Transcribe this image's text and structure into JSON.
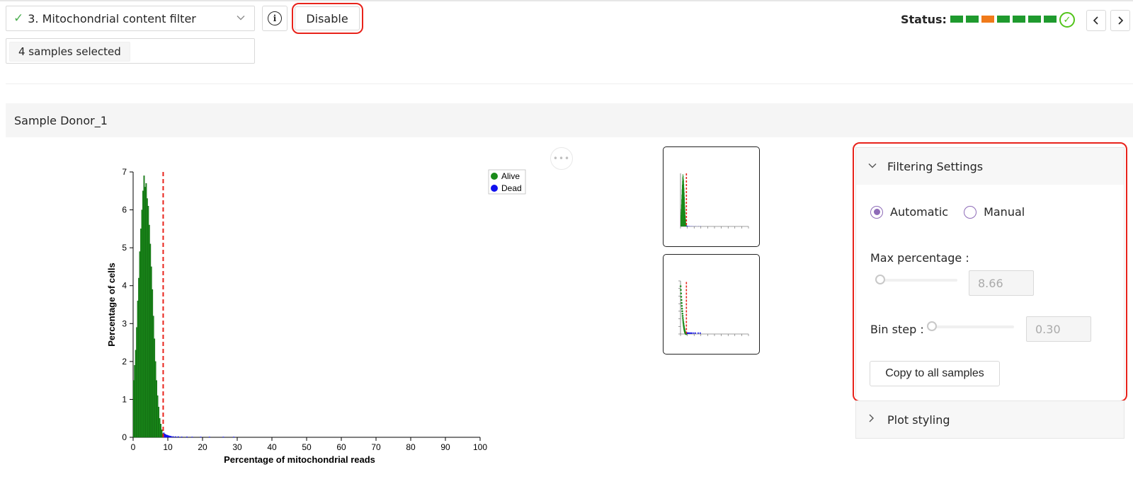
{
  "toolbar": {
    "step_check_icon": "check-icon",
    "step_label": "3. Mitochondrial content filter",
    "samples_tag": "4 samples selected",
    "info_icon": "info-icon",
    "disable_label": "Disable"
  },
  "status": {
    "label": "Status:",
    "segments": [
      "#1f9a2e",
      "#1f9a2e",
      "#f07a1a",
      "#1f9a2e",
      "#1f9a2e",
      "#1f9a2e",
      "#1f9a2e"
    ],
    "ok_icon": "check-circle-icon",
    "prev_icon": "chevron-left-icon",
    "next_icon": "chevron-right-icon"
  },
  "sample": {
    "header": "Sample Donor_1"
  },
  "chart_data": {
    "type": "bar",
    "xlabel": "Percentage of mitochondrial reads",
    "ylabel": "Percentage of cells",
    "xlim": [
      0,
      100
    ],
    "ylim": [
      0,
      7
    ],
    "x_ticks": [
      "0",
      "10",
      "20",
      "30",
      "40",
      "50",
      "60",
      "70",
      "80",
      "90",
      "100"
    ],
    "y_ticks": [
      "0",
      "1",
      "2",
      "3",
      "4",
      "5",
      "6",
      "7"
    ],
    "threshold": 8.66,
    "bin_step": 0.3,
    "legend": [
      {
        "name": "Alive",
        "color": "#1a8a1a"
      },
      {
        "name": "Dead",
        "color": "#1010ee"
      }
    ],
    "series": [
      {
        "name": "Alive",
        "color": "#1a8a1a",
        "x": [
          0.15,
          0.45,
          0.75,
          1.05,
          1.35,
          1.65,
          1.95,
          2.25,
          2.55,
          2.85,
          3.15,
          3.45,
          3.75,
          4.05,
          4.35,
          4.65,
          4.95,
          5.25,
          5.55,
          5.85,
          6.15,
          6.45,
          6.75,
          7.05,
          7.35,
          7.65,
          7.95,
          8.25,
          8.55
        ],
        "values": [
          1.5,
          1.9,
          2.3,
          2.9,
          3.6,
          4.2,
          4.9,
          5.5,
          6.0,
          6.5,
          6.9,
          6.6,
          6.7,
          6.3,
          6.1,
          5.6,
          5.1,
          4.5,
          3.9,
          3.2,
          2.6,
          2.0,
          1.5,
          1.1,
          0.8,
          0.5,
          0.35,
          0.2,
          0.1
        ]
      },
      {
        "name": "Dead",
        "color": "#1010ee",
        "x": [
          8.85,
          9.15,
          9.45,
          9.75,
          10.05,
          10.35,
          10.65,
          10.95,
          11.5,
          12.2,
          13.0,
          14.0,
          15.5,
          17.0,
          19.5,
          22.0,
          26.0,
          29.0
        ],
        "values": [
          0.12,
          0.09,
          0.07,
          0.06,
          0.05,
          0.04,
          0.035,
          0.03,
          0.025,
          0.02,
          0.02,
          0.015,
          0.015,
          0.01,
          0.01,
          0.01,
          0.005,
          0.005
        ]
      }
    ]
  },
  "filtering": {
    "title": "Filtering Settings",
    "chevron_icon": "chevron-down-icon",
    "auto_label": "Automatic",
    "manual_label": "Manual",
    "max_label": "Max percentage",
    "max_value": "8.66",
    "max_slider_fraction": 0.06,
    "bin_label": "Bin step",
    "bin_value": "0.30",
    "bin_slider_fraction": 0.03,
    "copy_label": "Copy to all samples"
  },
  "plot_styling": {
    "title": "Plot styling",
    "chevron_icon": "chevron-right-icon"
  }
}
